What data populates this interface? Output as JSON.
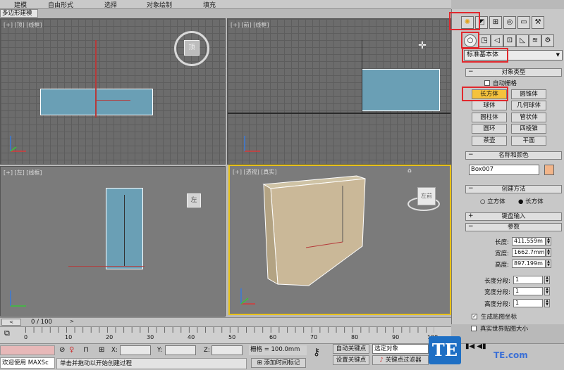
{
  "ribbon": {
    "tabs": [
      "建模",
      "自由形式",
      "选择",
      "对象绘制",
      "填充"
    ],
    "sub_tab": "多边形建模"
  },
  "viewports": {
    "top": {
      "label": "[+] [顶] [线框]",
      "cube_text": "顶"
    },
    "front": {
      "label": "[+] [前] [线框]"
    },
    "left": {
      "label": "[+] [左] [线框]",
      "cube_text": "左"
    },
    "perspective": {
      "label": "[+] [透视] [真实]",
      "cube_text": "左前"
    }
  },
  "command_panel": {
    "tab_icons": [
      "create-icon",
      "modify-icon",
      "hierarchy-icon",
      "motion-icon",
      "display-icon",
      "utilities-icon"
    ],
    "sub_icons": [
      "geometry-icon",
      "shapes-icon",
      "lights-icon",
      "cameras-icon",
      "helpers-icon",
      "spacewarps-icon",
      "systems-icon"
    ],
    "category_dropdown": "标准基本体",
    "object_type": {
      "header": "对象类型",
      "autogrid_label": "自动栅格",
      "buttons": [
        "长方体",
        "圆锥体",
        "球体",
        "几何球体",
        "圆柱体",
        "管状体",
        "圆环",
        "四棱锥",
        "茶壶",
        "平面"
      ]
    },
    "name_color": {
      "header": "名称和颜色",
      "name_value": "Box007",
      "swatch_color": "#f2b58a"
    },
    "creation_method": {
      "header": "创建方法",
      "options": [
        "立方体",
        "长方体"
      ],
      "selected": "长方体"
    },
    "keyboard_entry": {
      "header": "键盘输入"
    },
    "parameters": {
      "header": "参数",
      "length_label": "长度:",
      "length_value": "411.559m",
      "width_label": "宽度:",
      "width_value": "1662.7mm",
      "height_label": "高度:",
      "height_value": "897.199m",
      "length_segs_label": "长度分段:",
      "length_segs_value": "1",
      "width_segs_label": "宽度分段:",
      "width_segs_value": "1",
      "height_segs_label": "高度分段:",
      "height_segs_value": "1",
      "gen_mapping_label": "生成贴图坐标",
      "real_world_label": "真实世界贴图大小"
    }
  },
  "timeline": {
    "frame_label": "0 / 100",
    "ticks": [
      "0",
      "10",
      "20",
      "30",
      "40",
      "50",
      "60",
      "70",
      "80",
      "90",
      "100"
    ]
  },
  "status": {
    "welcome": "欢迎使用 MAXSc",
    "prompt": "单击并拖动以开始创建过程",
    "x_label": "X:",
    "y_label": "Y:",
    "z_label": "Z:",
    "grid_text": "栅格 = 100.0mm",
    "add_time_tag": "添加时间标记",
    "auto_key": "自动关键点",
    "set_key": "设置关键点",
    "selected_object": "选定对象",
    "key_filters": "关键点过滤器"
  },
  "watermark": {
    "logo_text": "TE",
    "site_text": "TE.com"
  }
}
